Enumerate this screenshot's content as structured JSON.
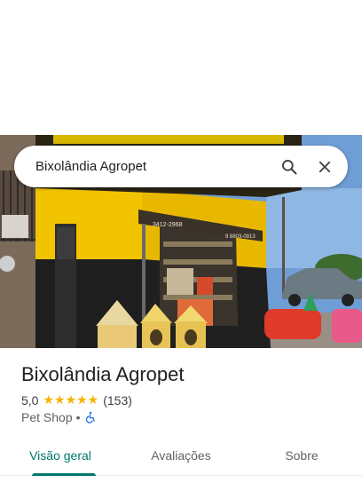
{
  "search": {
    "query": "Bixolândia Agropet"
  },
  "photo": {
    "sign_phone_left": "3412-2968",
    "sign_phone_right": "9 8803-0913"
  },
  "place": {
    "name": "Bixolândia Agropet",
    "rating_value": "5,0",
    "stars": "★★★★★",
    "review_count": "(153)",
    "category": "Pet Shop",
    "separator": "•"
  },
  "tabs": [
    {
      "label": "Visão geral",
      "active": true
    },
    {
      "label": "Avaliações",
      "active": false
    },
    {
      "label": "Sobre",
      "active": false
    }
  ],
  "colors": {
    "accent": "#00796b",
    "star": "#f4b400",
    "accessibility_icon": "#1a73e8"
  }
}
